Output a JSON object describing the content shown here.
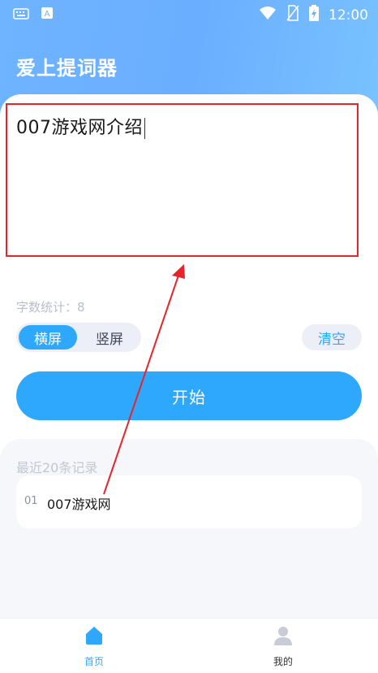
{
  "status_bar": {
    "time": "12:00",
    "icons": [
      "keyboard-icon",
      "text-input-icon",
      "wifi-icon",
      "no-sim-icon",
      "battery-charging-icon"
    ]
  },
  "app": {
    "title": "爱上提词器"
  },
  "editor": {
    "text": "007游戏网介绍",
    "word_count": "字数统计：8"
  },
  "orientation": {
    "options": [
      "横屏",
      "竖屏"
    ],
    "selected": "横屏"
  },
  "actions": {
    "clear_label": "清空",
    "start_label": "开始"
  },
  "history": {
    "title": "最近20条记录",
    "items": [
      {
        "index": "01",
        "text": "007游戏网"
      }
    ]
  },
  "tab_bar": {
    "tabs": [
      {
        "label": "首页",
        "icon": "home-icon",
        "active": true
      },
      {
        "label": "我的",
        "icon": "user-icon",
        "active": false
      }
    ]
  },
  "colors": {
    "accent": "#2ea8fd",
    "header_gradient_start": "#6fb4ff",
    "header_gradient_end": "#79c3ff",
    "annotation": "#e8232a"
  }
}
